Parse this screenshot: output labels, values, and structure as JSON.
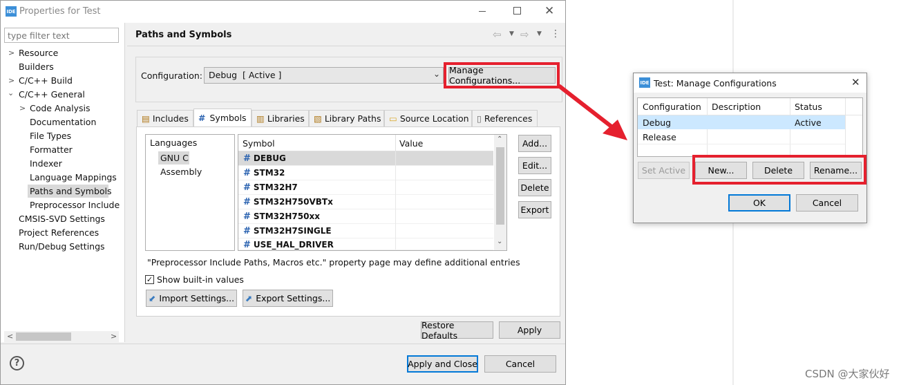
{
  "props_window": {
    "title": "Properties for Test",
    "app_icon": "IDE",
    "filter_placeholder": "type filter text",
    "tree": [
      {
        "label": "Resource",
        "chevron": ">"
      },
      {
        "label": "Builders"
      },
      {
        "label": "C/C++ Build",
        "chevron": ">"
      },
      {
        "label": "C/C++ General",
        "chevron": "v"
      },
      {
        "label": "Code Analysis",
        "chevron": ">"
      },
      {
        "label": "Documentation"
      },
      {
        "label": "File Types"
      },
      {
        "label": "Formatter"
      },
      {
        "label": "Indexer"
      },
      {
        "label": "Language Mappings"
      },
      {
        "label": "Paths and Symbols"
      },
      {
        "label": "Preprocessor Include"
      },
      {
        "label": "CMSIS-SVD Settings"
      },
      {
        "label": "Project References"
      },
      {
        "label": "Run/Debug Settings"
      }
    ],
    "page_title": "Paths and Symbols",
    "config_label": "Configuration:",
    "config_value": "Debug  [ Active ]",
    "manage_btn": "Manage Configurations...",
    "tabs": [
      "Includes",
      "Symbols",
      "Libraries",
      "Library Paths",
      "Source Location",
      "References"
    ],
    "languages_header": "Languages",
    "languages": [
      "GNU C",
      "Assembly"
    ],
    "symbol_col": "Symbol",
    "value_col": "Value",
    "symbols": [
      "DEBUG",
      "STM32",
      "STM32H7",
      "STM32H750VBTx",
      "STM32H750xx",
      "STM32H7SINGLE",
      "USE_HAL_DRIVER"
    ],
    "side_buttons": [
      "Add...",
      "Edit...",
      "Delete",
      "Export"
    ],
    "note": "\"Preprocessor Include Paths, Macros etc.\" property page may define additional entries",
    "show_builtin": "Show built-in values",
    "import_btn": "Import Settings...",
    "export_btn": "Export Settings...",
    "restore_btn": "Restore Defaults",
    "apply_btn": "Apply",
    "apply_close_btn": "Apply and Close",
    "cancel_btn": "Cancel",
    "help_icon": "?"
  },
  "manage_dialog": {
    "title": "Test: Manage Configurations",
    "app_icon": "IDE",
    "col_configuration": "Configuration",
    "col_description": "Description",
    "col_status": "Status",
    "rows": [
      {
        "configuration": "Debug",
        "description": "",
        "status": "Active"
      },
      {
        "configuration": "Release",
        "description": "",
        "status": ""
      }
    ],
    "set_active_btn": "Set Active",
    "new_btn": "New...",
    "delete_btn": "Delete",
    "rename_btn": "Rename...",
    "ok_btn": "OK",
    "cancel_btn": "Cancel"
  },
  "watermark": "CSDN @大家伙好",
  "colors": {
    "annotation_red": "#e5202e",
    "selection": "#cce8ff",
    "ide_blue": "#3c8fd8"
  }
}
